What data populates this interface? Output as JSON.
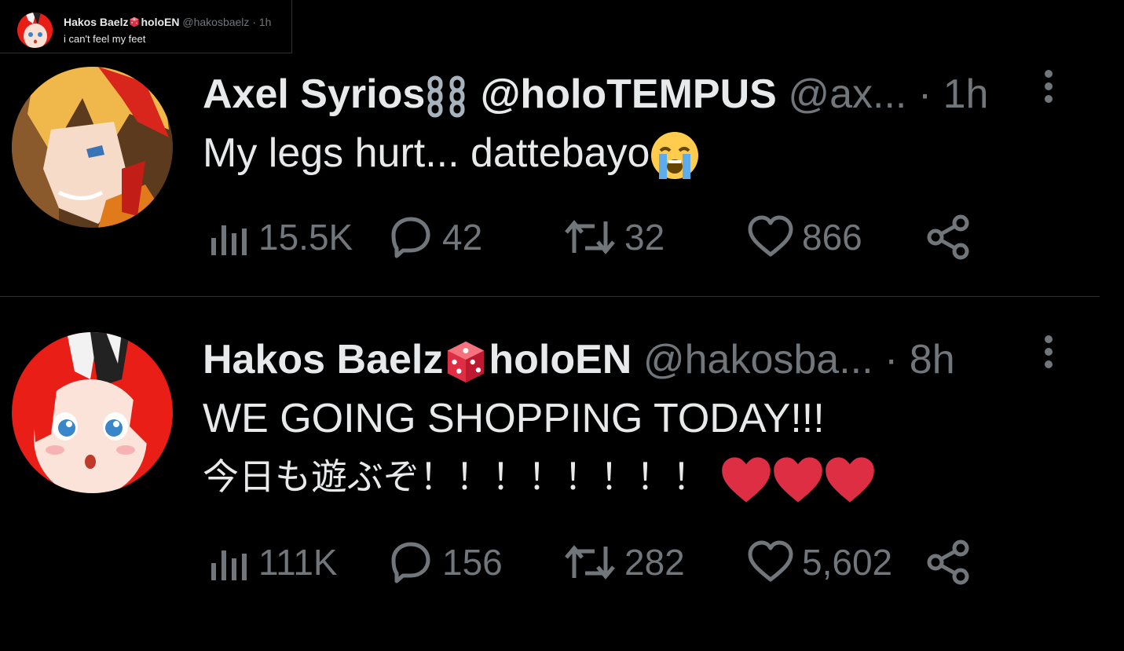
{
  "quoted": {
    "name": "Hakos Baelz",
    "org": "holoEN",
    "handle": "@hakosbaelz",
    "separator": "·",
    "time": "1h",
    "text": "i can't feel my feet"
  },
  "tweets": [
    {
      "name": "Axel Syrios",
      "org": "@holoTEMPUS",
      "handle": "@ax...",
      "separator": "·",
      "time": "1h",
      "text": "My legs hurt... dattebayo",
      "views": "15.5K",
      "replies": "42",
      "retweets": "32",
      "likes": "866",
      "avatar_palette": [
        "#f0b84a",
        "#d8261c",
        "#7a3c12"
      ]
    },
    {
      "name": "Hakos Baelz",
      "org": "holoEN",
      "handle": "@hakosba...",
      "separator": "·",
      "time": "8h",
      "text_line1": "WE GOING SHOPPING TODAY!!!",
      "text_line2": "今日も遊ぶぞ！！！！！！！！",
      "views": "111K",
      "replies": "156",
      "retweets": "282",
      "likes": "5,602",
      "avatar_palette": [
        "#e81e17",
        "#f2f2f2",
        "#222222"
      ]
    }
  ],
  "colors": {
    "background": "#000000",
    "text_primary": "#e7e9ea",
    "text_secondary": "#71767b",
    "divider": "#2f3336",
    "dice_red": "#dd2e44",
    "heart_red": "#dd2e44"
  },
  "icons": [
    "views-icon",
    "reply-icon",
    "retweet-icon",
    "like-icon",
    "share-icon",
    "more-icon",
    "chains-emoji",
    "crying-emoji",
    "dice-emoji",
    "heart-emoji"
  ]
}
